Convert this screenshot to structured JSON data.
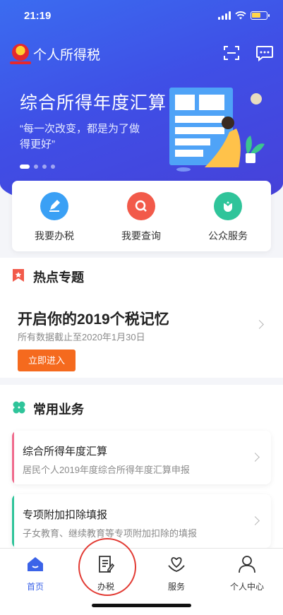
{
  "status_bar": {
    "time": "21:19"
  },
  "app": {
    "title": "个人所得税"
  },
  "banner": {
    "title": "综合所得年度汇算",
    "subtitle": "“每一次改变，都是为了做得更好”"
  },
  "quick_actions": [
    {
      "label": "我要办税",
      "icon": "pen-icon",
      "color": "#3aa0f5"
    },
    {
      "label": "我要查询",
      "icon": "search-icon",
      "color": "#f25a4a"
    },
    {
      "label": "公众服务",
      "icon": "flower-icon",
      "color": "#2fc49a"
    }
  ],
  "hot_topics": {
    "heading": "热点专题",
    "title": "开启你的2019个税记忆",
    "subtitle": "所有数据截止至2020年1月30日",
    "button": "立即进入"
  },
  "common_services": {
    "heading": "常用业务",
    "items": [
      {
        "title": "综合所得年度汇算",
        "desc": "居民个人2019年度综合所得年度汇算申报",
        "accent": "#f06a8c"
      },
      {
        "title": "专项附加扣除填报",
        "desc": "子女教育、继续教育等专项附加扣除的填报",
        "accent": "#2fc49a"
      }
    ]
  },
  "tab_bar": [
    {
      "label": "首页",
      "icon": "home-icon",
      "active": true
    },
    {
      "label": "办税",
      "icon": "form-icon",
      "active": false
    },
    {
      "label": "服务",
      "icon": "heart-hands-icon",
      "active": false
    },
    {
      "label": "个人中心",
      "icon": "user-icon",
      "active": false
    }
  ],
  "colors": {
    "primary": "#3b63e8",
    "orange": "#f56a1e"
  }
}
